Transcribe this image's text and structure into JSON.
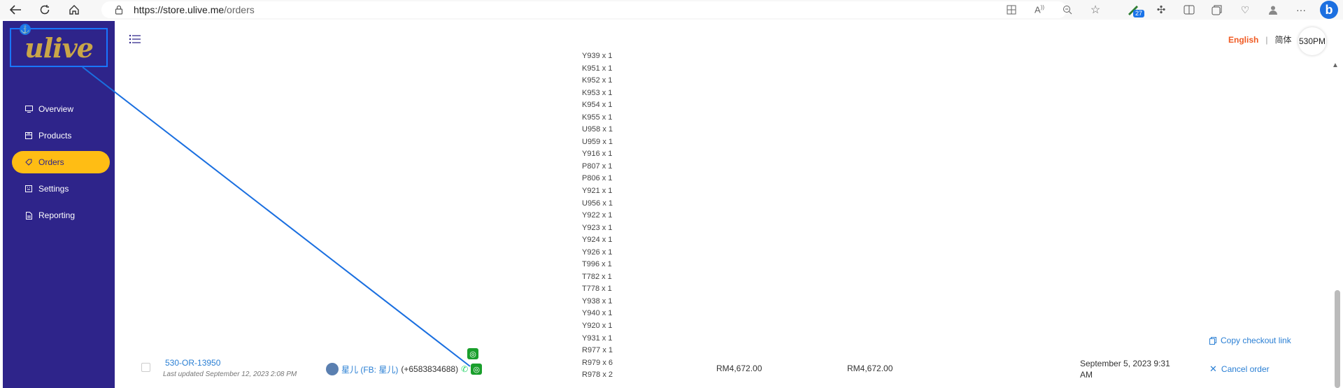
{
  "browser": {
    "url_host": "https://store.ulive.me",
    "url_path": "/orders",
    "notification_count": "27"
  },
  "sidebar": {
    "logo": "ulive",
    "items": [
      {
        "label": "Overview",
        "icon": "monitor-icon"
      },
      {
        "label": "Products",
        "icon": "products-icon"
      },
      {
        "label": "Orders",
        "icon": "tag-icon",
        "active": true
      },
      {
        "label": "Settings",
        "icon": "settings-icon"
      },
      {
        "label": "Reporting",
        "icon": "report-icon"
      }
    ]
  },
  "header": {
    "lang_en": "English",
    "lang_sep": "|",
    "lang_zh": "简体",
    "user": "530PM"
  },
  "order_items": [
    "Y939 x 1",
    "K951 x 1",
    "K952 x 1",
    "K953 x 1",
    "K954 x 1",
    "K955 x 1",
    "U958 x 1",
    "U959 x 1",
    "Y916 x 1",
    "P807 x 1",
    "P806 x 1",
    "Y921 x 1",
    "U956 x 1",
    "Y922 x 1",
    "Y923 x 1",
    "Y924 x 1",
    "Y926 x 1",
    "T996 x 1",
    "T782 x 1",
    "T778 x 1",
    "Y938 x 1",
    "Y940 x 1",
    "Y920 x 1",
    "Y931 x 1",
    "R977 x 1",
    "R979 x 6",
    "R978 x 2"
  ],
  "order": {
    "id": "530-OR-13950",
    "last_updated": "Last updated September 12, 2023 2:08 PM",
    "customer_name": "星儿 (FB: 星儿)",
    "customer_phone": "(+6583834688)",
    "subtotal": "RM4,672.00",
    "total": "RM4,672.00",
    "date": "September 5, 2023 9:31 AM",
    "action_copy": "Copy checkout link",
    "action_cancel": "Cancel order"
  },
  "colors": {
    "sidebar": "#2e248a",
    "active": "#ffbd14",
    "link": "#2a7fd4",
    "lang_active": "#f05a22"
  }
}
